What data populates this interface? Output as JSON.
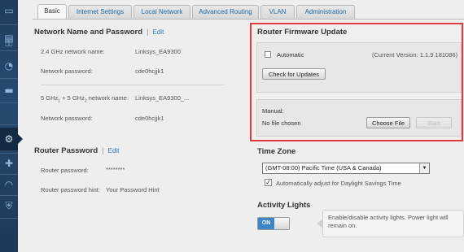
{
  "tabs": [
    {
      "label": "Basic"
    },
    {
      "label": "Internet Settings"
    },
    {
      "label": "Local Network"
    },
    {
      "label": "Advanced Routing"
    },
    {
      "label": "VLAN"
    },
    {
      "label": "Administration"
    }
  ],
  "network": {
    "title": "Network Name and Password",
    "edit": "Edit",
    "rows": [
      {
        "label": "2.4 GHz network name:",
        "value": "Linksys_EA9300"
      },
      {
        "label": "Network password:",
        "value": "cde0hcjjk1"
      },
      {
        "label_main": "5 GHz",
        "label_sub1": "1",
        "label_mid": " + 5 GHz",
        "label_sub2": "2",
        "label_end": " network name:",
        "value": "Linksys_EA9300_..."
      },
      {
        "label": "Network password:",
        "value": "cde0hcjjk1"
      }
    ]
  },
  "router_password": {
    "title": "Router Password",
    "edit": "Edit",
    "password_label": "Router password:",
    "password_value": "********",
    "hint_label": "Router password hint:",
    "hint_value": "Your Password Hint"
  },
  "firmware": {
    "title": "Router Firmware Update",
    "automatic_label": "Automatic",
    "automatic_checked": false,
    "current_version": "(Current Version: 1.1.9.181086)",
    "check_button": "Check for Updates",
    "manual_label": "Manual:",
    "file_status": "No file chosen",
    "choose_button": "Choose File",
    "start_button": "Start"
  },
  "timezone": {
    "title": "Time Zone",
    "selected": "(GMT-08:00) Pacific Time (USA & Canada)",
    "dst_label": "Automatically adjust for Daylight Savings Time",
    "dst_checked": true
  },
  "activity_lights": {
    "title": "Activity Lights",
    "toggle_label": "ON",
    "description": "Enable/disable activity lights. Power light will remain on."
  },
  "colors": {
    "nav_bg": "#1f3d5e",
    "link": "#2a77c0",
    "highlight_border": "#e03a3a",
    "toggle_on": "#3a86c8"
  }
}
